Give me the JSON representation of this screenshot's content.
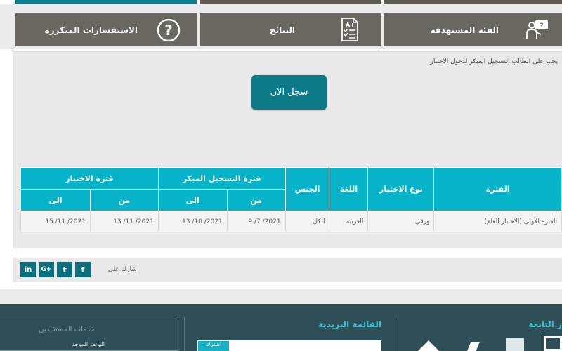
{
  "tabs": [
    {
      "label": "الاستفسارات المتكررة",
      "icon": "question-circle-icon"
    },
    {
      "label": "النتائج",
      "icon": "results-checklist-icon"
    },
    {
      "label": "الفئة المستهدفة",
      "icon": "target-audience-icon"
    }
  ],
  "notice": "يجب على الطالب التسجيل المبكر لدخول الاختبار",
  "register_button": "سجل الان",
  "table": {
    "headers": {
      "period": "الفترة",
      "test_type": "نوع الاختبار",
      "language": "اللغة",
      "gender": "الجنس",
      "early_registration": "فترة التسجيل المبكر",
      "test_period": "فترة الاختبار",
      "from": "من",
      "to": "الى"
    },
    "rows": [
      {
        "period": "الفترة الأولى (الاختبار العام)",
        "test_type": "ورقي",
        "language": "العربية",
        "gender": "الكل",
        "reg_from": "2021/ 7/ 9",
        "reg_to": "2021/ 10/ 13",
        "test_from": "2021/ 11/ 13",
        "test_to": "2021/ 11/ 15"
      }
    ]
  },
  "share": {
    "label": "شارك على",
    "icons": [
      "facebook-icon",
      "twitter-icon",
      "google-plus-icon",
      "linkedin-icon"
    ],
    "glyphs": [
      "f",
      "t",
      "G+",
      "in"
    ]
  },
  "footer": {
    "affiliated_title": "ز التابعة",
    "mailing_list_title": "القائمة البريدية",
    "services_title": "خدمات المستفيدين",
    "services_item": "الهاتف الموحد",
    "mail_button": "اشترك"
  },
  "colors": {
    "tab_bg": "#6a6660",
    "accent_teal": "#0d7a87",
    "table_header": "#07b3c9",
    "footer_bg": "#2e4f58",
    "footer_title": "#35c4d6"
  }
}
